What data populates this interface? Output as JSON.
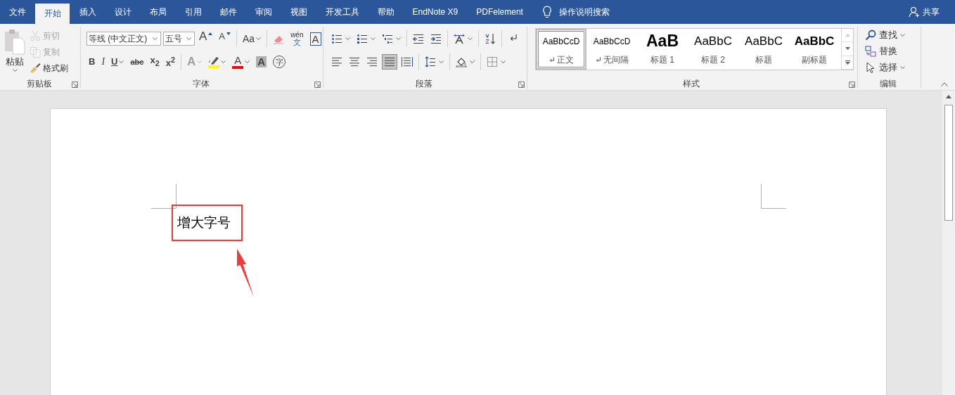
{
  "tabs": [
    {
      "label": "文件",
      "selected": false
    },
    {
      "label": "开始",
      "selected": true
    },
    {
      "label": "插入",
      "selected": false
    },
    {
      "label": "设计",
      "selected": false
    },
    {
      "label": "布局",
      "selected": false
    },
    {
      "label": "引用",
      "selected": false
    },
    {
      "label": "邮件",
      "selected": false
    },
    {
      "label": "审阅",
      "selected": false
    },
    {
      "label": "视图",
      "selected": false
    },
    {
      "label": "开发工具",
      "selected": false
    },
    {
      "label": "帮助",
      "selected": false
    },
    {
      "label": "EndNote X9",
      "selected": false
    },
    {
      "label": "PDFelement",
      "selected": false
    }
  ],
  "tell_me": {
    "label": "操作说明搜索"
  },
  "share": {
    "label": "共享"
  },
  "clipboard": {
    "paste": "粘贴",
    "commands": [
      {
        "kind": "cut",
        "label": "剪切",
        "disabled": true
      },
      {
        "kind": "copy",
        "label": "复制",
        "disabled": true
      },
      {
        "kind": "painter",
        "label": "格式刷",
        "disabled": false
      }
    ],
    "group_label": "剪贴板"
  },
  "font": {
    "font_name": "等线 (中文正文)",
    "font_size": "五号",
    "row_1": [
      [
        {
          "kind": "grow",
          "glyph": "A",
          "caret": false
        },
        {
          "kind": "shrink",
          "glyph": "A",
          "caret": false
        }
      ],
      [
        {
          "kind": "case",
          "glyph": "Aa",
          "caret": true
        }
      ],
      [
        {
          "kind": "clear",
          "caret": false
        },
        {
          "kind": "pinyin",
          "glyph": "wén",
          "sub": "文",
          "caret": false
        },
        {
          "kind": "border",
          "glyph": "A",
          "caret": false
        }
      ]
    ],
    "row_2": [
      [
        {
          "kind": "bold",
          "glyph": "B",
          "caret": false,
          "disabled": false
        },
        {
          "kind": "italic",
          "glyph": "I",
          "caret": false,
          "disabled": false
        },
        {
          "kind": "underline",
          "glyph": "U",
          "caret": true,
          "disabled": false
        },
        {
          "kind": "strike",
          "glyph": "abc",
          "caret": false,
          "disabled": false
        },
        {
          "kind": "subscript",
          "glyph": "x$_{2}$",
          "caret": false,
          "disabled": false
        },
        {
          "kind": "superscript",
          "glyph": "x$^{2}$",
          "caret": false,
          "disabled": false
        }
      ],
      [
        {
          "kind": "effect",
          "glyph": "A",
          "caret": true,
          "disabled": true
        },
        {
          "kind": "highlight",
          "color": "#ffff00",
          "caret": true,
          "disabled": false
        },
        {
          "kind": "font-color",
          "glyph": "A",
          "color": "#ff0000",
          "caret": true,
          "disabled": false
        },
        {
          "kind": "shading",
          "glyph": "A",
          "caret": false,
          "disabled": false
        },
        {
          "kind": "enclosed",
          "glyph": "字",
          "caret": false,
          "disabled": false
        }
      ]
    ],
    "group_label": "字体"
  },
  "paragraph": {
    "row_1": [
      [
        {
          "kind": "bullets",
          "caret": true
        },
        {
          "kind": "numbering",
          "caret": true
        },
        {
          "kind": "multilevel",
          "caret": true
        }
      ],
      [
        {
          "kind": "outdent",
          "caret": false
        },
        {
          "kind": "indent",
          "caret": false
        }
      ],
      [
        {
          "kind": "asian-layout",
          "caret": true
        }
      ],
      [
        {
          "kind": "sort",
          "caret": false
        }
      ],
      [
        {
          "kind": "marks",
          "caret": false
        }
      ]
    ],
    "alignment": [
      {
        "kind": "left",
        "selected": false
      },
      {
        "kind": "center",
        "selected": false
      },
      {
        "kind": "right",
        "selected": false
      },
      {
        "kind": "justify",
        "selected": true
      },
      {
        "kind": "distributed",
        "selected": false
      }
    ],
    "row_2": [
      [
        {
          "kind": "line-spacing",
          "caret": true
        }
      ],
      [
        {
          "kind": "shading",
          "caret": true
        }
      ],
      [
        {
          "kind": "borders",
          "caret": true
        }
      ]
    ],
    "group_label": "段落"
  },
  "styles": {
    "items": [
      {
        "kind": "normal",
        "preview": "AaBbCcD",
        "name": "正文",
        "mark": true,
        "selected": true
      },
      {
        "kind": "normal",
        "preview": "AaBbCcD",
        "name": "无间隔",
        "mark": true,
        "selected": false
      },
      {
        "kind": "h1",
        "preview": "AaB",
        "name": "标题 1",
        "mark": false,
        "selected": false
      },
      {
        "kind": "h2",
        "preview": "AaBbC",
        "name": "标题 2",
        "mark": false,
        "selected": false
      },
      {
        "kind": "title",
        "preview": "AaBbC",
        "name": "标题",
        "mark": false,
        "selected": false
      },
      {
        "kind": "subtitle",
        "preview": "AaBbC",
        "name": "副标题",
        "mark": false,
        "selected": false
      }
    ],
    "group_label": "样式"
  },
  "editing": {
    "commands": [
      {
        "kind": "find",
        "label": "查找",
        "caret": true
      },
      {
        "kind": "replace",
        "label": "替换",
        "caret": false
      },
      {
        "kind": "select",
        "label": "选择",
        "caret": true
      }
    ],
    "group_label": "编辑"
  },
  "document": {
    "text": "增大字号"
  }
}
